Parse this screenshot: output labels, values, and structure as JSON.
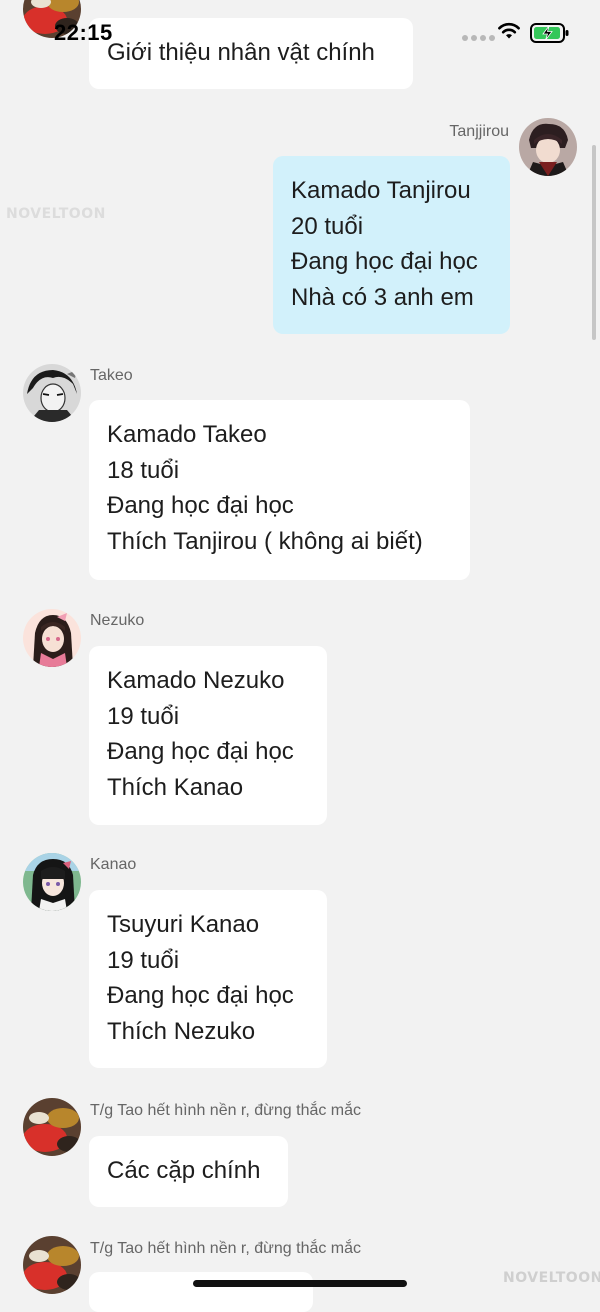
{
  "status_bar": {
    "time": "22:15",
    "battery_color": "#34c759",
    "icons": [
      "signal-dots-icon",
      "wifi-icon",
      "battery-charging-icon"
    ]
  },
  "watermark": {
    "top": "NOVELTOON",
    "bottom": "NOVELTOON"
  },
  "messages": [
    {
      "sender": "",
      "side": "left",
      "avatar": "food-avatar",
      "lines": [
        "Giới thiệu nhân vật chính"
      ]
    },
    {
      "sender": "Tanjjirou",
      "side": "right",
      "avatar": "tanjirou-avatar",
      "lines": [
        "Kamado Tanjirou",
        "20 tuổi",
        "Đang học đại học",
        "Nhà có 3 anh em"
      ]
    },
    {
      "sender": "Takeo",
      "side": "left",
      "avatar": "takeo-avatar",
      "lines": [
        "Kamado Takeo",
        "18 tuổi",
        "Đang học đại học",
        "Thích Tanjirou ( không ai biết)"
      ]
    },
    {
      "sender": "Nezuko",
      "side": "left",
      "avatar": "nezuko-avatar",
      "lines": [
        "Kamado Nezuko",
        "19 tuổi",
        "Đang học đại học",
        "Thích Kanao"
      ]
    },
    {
      "sender": "Kanao",
      "side": "left",
      "avatar": "kanao-avatar",
      "lines": [
        "Tsuyuri Kanao",
        "19 tuổi",
        "Đang học đại học",
        "Thích Nezuko"
      ]
    },
    {
      "sender": "T/g Tao hết hình nền r, đừng thắc mắc",
      "side": "left",
      "avatar": "food-avatar",
      "lines": [
        "Các cặp chính"
      ]
    },
    {
      "sender": "T/g Tao hết hình nền r, đừng thắc mắc",
      "side": "left",
      "avatar": "food-avatar",
      "lines": []
    }
  ]
}
